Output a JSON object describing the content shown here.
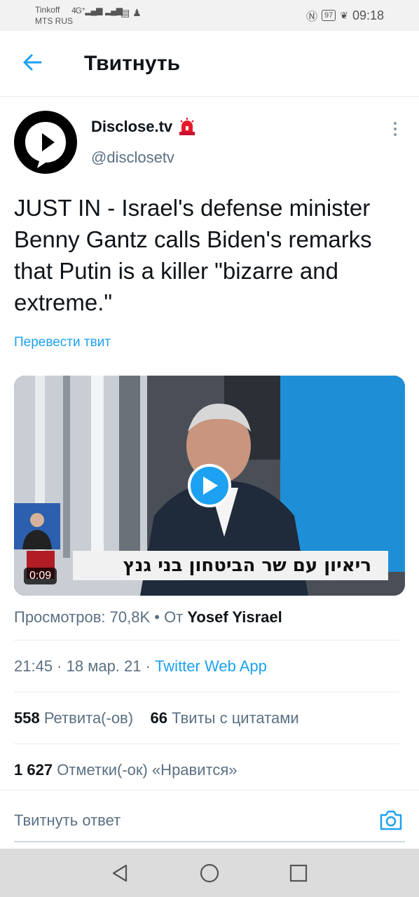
{
  "status_bar": {
    "carrier_line1": "Tinkoff",
    "carrier_line2": "MTS RUS",
    "network_label": "4G⁺",
    "battery_level": "97",
    "time": "09:18"
  },
  "header": {
    "back_icon": "arrow-left-icon",
    "title": "Твитнуть"
  },
  "tweet": {
    "author_name": "Disclose.tv",
    "author_badge_icon": "siren-emoji-icon",
    "author_handle": "@disclosetv",
    "text": "JUST IN - Israel's defense minister Benny Gantz calls Biden's remarks that Putin is a killer \"bizarre and extreme.\"",
    "translate_label": "Перевести твит",
    "media": {
      "chyron_text": "ריאיון עם שר הביטחון בני גנץ",
      "duration": "0:09",
      "play_icon": "play-icon"
    },
    "views_label": "Просмотров: 70,8K",
    "views_separator": " • ",
    "views_from": "От",
    "views_source": "Yosef Yisrael",
    "time": "21:45",
    "dot1": " · ",
    "date": "18 мар. 21",
    "dot2": " · ",
    "client": "Twitter Web App",
    "retweets_count": "558",
    "retweets_label": "Ретвита(-ов)",
    "quotes_count": "66",
    "quotes_label": "Твиты с цитатами",
    "likes_count": "1 627",
    "likes_label": "Отметки(-ок) «Нравится»"
  },
  "reply": {
    "placeholder": "Твитнуть ответ",
    "camera_icon": "camera-icon"
  },
  "navbar": {
    "back_icon": "nav-back-triangle-icon",
    "home_icon": "nav-home-circle-icon",
    "recents_icon": "nav-recents-square-icon"
  },
  "colors": {
    "accent": "#1da1f2",
    "text_primary": "#0f1419",
    "text_secondary": "#5b7083",
    "divider": "#e6ecf0"
  }
}
